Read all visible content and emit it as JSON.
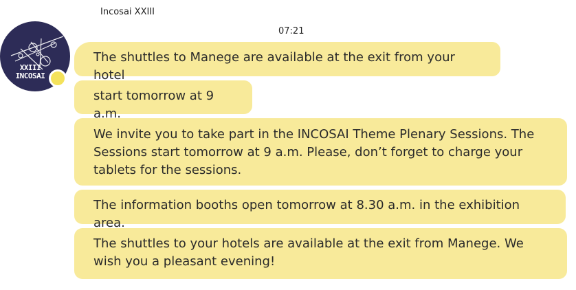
{
  "chat": {
    "sender_name": "Incosai XXIII",
    "timestamp": "07:21",
    "avatar": {
      "line1": "XXIII",
      "line2": "INCOSAI",
      "status_color": "#f4e25b"
    },
    "messages": [
      {
        "text": "The shuttles to Manege are available at the exit from your hotel"
      },
      {
        "text": "start tomorrow at 9 a.m."
      },
      {
        "text": "We invite you to take part in the INCOSAI Theme Plenary Sessions. The Sessions start tomorrow at 9 a.m. Please, don’t forget to charge your tablets for the sessions."
      },
      {
        "text": "The information booths open tomorrow at 8.30 a.m. in the exhibition area."
      },
      {
        "text": "The shuttles to your hotels are available at the exit from Manege. We wish you a pleasant evening!"
      }
    ],
    "colors": {
      "bubble": "#f8ea9a",
      "avatar_bg": "#2d2c57"
    }
  }
}
